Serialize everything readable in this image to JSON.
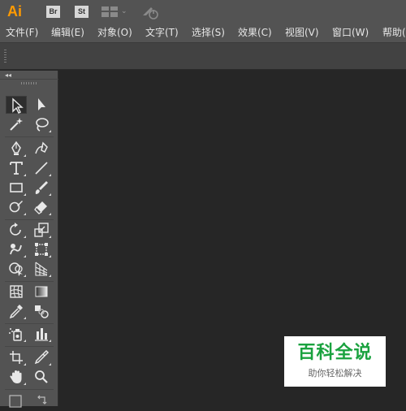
{
  "app": {
    "logo": "Ai",
    "badges": [
      "Br",
      "St"
    ],
    "brand_color": "#ff9a00"
  },
  "menu": [
    {
      "label": "文件(F)"
    },
    {
      "label": "编辑(E)"
    },
    {
      "label": "对象(O)"
    },
    {
      "label": "文字(T)"
    },
    {
      "label": "选择(S)"
    },
    {
      "label": "效果(C)"
    },
    {
      "label": "视图(V)"
    },
    {
      "label": "窗口(W)"
    },
    {
      "label": "帮助("
    }
  ],
  "toolbar": {
    "collapse_glyph": "◂◂",
    "tools": [
      [
        "selection-tool-icon",
        "direct-selection-tool-icon"
      ],
      [
        "magic-wand-tool-icon",
        "lasso-tool-icon"
      ],
      [
        "pen-tool-icon",
        "curvature-tool-icon"
      ],
      [
        "type-tool-icon",
        "line-segment-tool-icon"
      ],
      [
        "rectangle-tool-icon",
        "paintbrush-tool-icon"
      ],
      [
        "shaper-tool-icon",
        "eraser-tool-icon"
      ],
      [
        "rotate-tool-icon",
        "scale-tool-icon"
      ],
      [
        "warp-tool-icon",
        "free-transform-tool-icon"
      ],
      [
        "shape-builder-tool-icon",
        "perspective-grid-tool-icon"
      ],
      [
        "mesh-tool-icon",
        "gradient-tool-icon"
      ],
      [
        "eyedropper-tool-icon",
        "blend-tool-icon"
      ],
      [
        "symbol-sprayer-tool-icon",
        "column-graph-tool-icon"
      ],
      [
        "artboard-tool-icon",
        "slice-tool-icon"
      ],
      [
        "hand-tool-icon",
        "zoom-tool-icon"
      ]
    ],
    "active_tool": "selection-tool-icon"
  },
  "watermark": {
    "title": "百科全说",
    "subtitle": "助你轻松解决",
    "color": "#1aa23f"
  }
}
